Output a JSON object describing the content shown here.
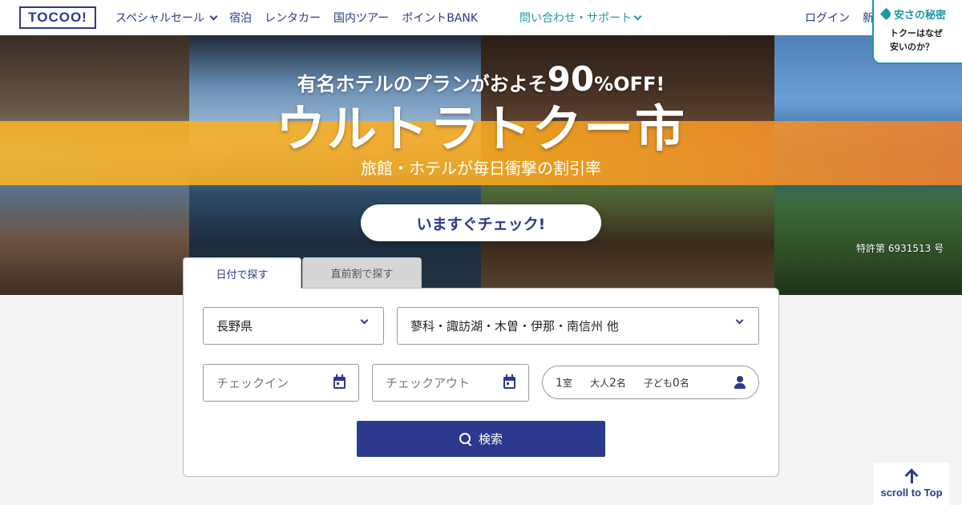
{
  "header": {
    "logo": "TOCOO!",
    "nav": [
      {
        "label": "スペシャルセール",
        "dropdown": true
      },
      {
        "label": "宿泊",
        "dropdown": false
      },
      {
        "label": "レンタカー",
        "dropdown": false
      },
      {
        "label": "国内ツアー",
        "dropdown": false
      },
      {
        "label": "ポイントBANK",
        "dropdown": false
      }
    ],
    "support_label": "問い合わせ・サポート",
    "login_label": "ログイン",
    "signup_label": "新",
    "secret": {
      "title": "安さの秘密",
      "line1": "トクーはなぜ",
      "line2": "安いのか？"
    }
  },
  "hero": {
    "tagline_pre": "有名ホテルのプランがおよそ",
    "tagline_number": "90",
    "tagline_post": "%OFF!",
    "title": "ウルトラトクー市",
    "description": "旅館・ホテルが毎日衝撃の割引率",
    "cta": "いますぐチェック!",
    "patent": "特許第 6931513 号"
  },
  "search": {
    "tabs": [
      {
        "label": "日付で探す",
        "active": true
      },
      {
        "label": "直前割で探す",
        "active": false
      }
    ],
    "prefecture": "長野県",
    "area": "蓼科・諏訪湖・木曽・伊那・南信州 他",
    "checkin_placeholder": "チェックイン",
    "checkout_placeholder": "チェックアウト",
    "guests": {
      "rooms": "1",
      "rooms_unit": "室",
      "adults_label": "大人",
      "adults": "2",
      "adults_unit": "名",
      "children_label": "子ども",
      "children": "0",
      "children_unit": "名"
    },
    "button": "検索"
  },
  "scroll_top": "scroll to Top",
  "colors": {
    "brand": "#2b3a8c",
    "accent": "#1a9aa0",
    "band": "#f8b428"
  }
}
